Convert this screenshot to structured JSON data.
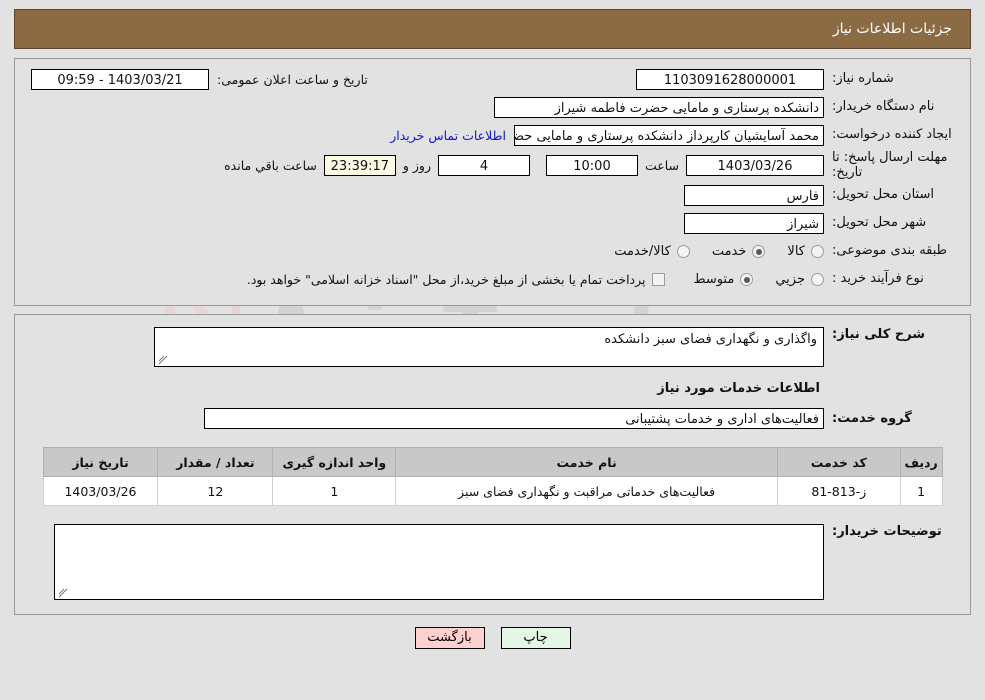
{
  "header": {
    "title": "جزئیات اطلاعات نیاز",
    "bar_color": "#8b6b44"
  },
  "watermark": {
    "text": "AriaTender.net",
    "shield_color": "#f0d2d2",
    "text_color": "#cccccc"
  },
  "top_panel": {
    "need_number": {
      "label": "شماره نیاز:",
      "value": "1103091628000001"
    },
    "announce": {
      "label": "تاریخ و ساعت اعلان عمومی:",
      "value": "09:59 - 1403/03/21"
    },
    "buyer_org": {
      "label": "نام دستگاه خریدار:",
      "value": "دانشکده پرستاری و مامایی حضرت فاطمه شیراز"
    },
    "creator": {
      "label": "ایجاد کننده درخواست:",
      "value": "محمد آسایشیان کارپرداز دانشکده پرستاری و مامایی حضرت فاطمه شیراز",
      "contact_link": "اطلاعات تماس خریدار"
    },
    "deadline": {
      "label": "مهلت ارسال پاسخ: تا تاریخ:",
      "date": "1403/03/26",
      "time_label": "ساعت",
      "time": "10:00",
      "days": "4",
      "days_label": "روز و",
      "remaining": "23:39:17",
      "remaining_label": "ساعت باقي مانده"
    },
    "province": {
      "label": "استان محل تحویل:",
      "value": "فارس"
    },
    "city": {
      "label": "شهر محل تحویل:",
      "value": "شیراز"
    },
    "category": {
      "label": "طبقه بندی موضوعی:",
      "options": [
        {
          "label": "کالا",
          "selected": false
        },
        {
          "label": "خدمت",
          "selected": true
        },
        {
          "label": "کالا/خدمت",
          "selected": false
        }
      ]
    },
    "process_type": {
      "label": "نوع فرآیند خرید :",
      "options": [
        {
          "label": "جزیي",
          "selected": false
        },
        {
          "label": "متوسط",
          "selected": true
        }
      ],
      "checkbox": {
        "checked": false,
        "note": "پرداخت تمام یا بخشی از مبلغ خرید،از محل \"اسناد خزانه اسلامی\" خواهد بود."
      }
    }
  },
  "mid_panel": {
    "general_desc": {
      "label": "شرح کلی نیاز:",
      "value": "واگذاری و نگهداری فضای سبز دانشکده"
    },
    "section_title": "اطلاعات خدمات مورد نیاز",
    "service_group": {
      "label": "گروه خدمت:",
      "value": "فعالیت‌های اداری و خدمات پشتیبانی"
    },
    "table": {
      "columns": [
        "ردیف",
        "کد خدمت",
        "نام خدمت",
        "واحد اندازه گیری",
        "تعداد / مقدار",
        "تاریخ نیاز"
      ],
      "rows": [
        {
          "radif": "1",
          "code": "ز-813-81",
          "name": "فعالیت‌های خدماتی مراقبت و نگهداری فضای سبز",
          "unit": "1",
          "qty": "12",
          "date": "1403/03/26"
        }
      ]
    },
    "buyer_notes": {
      "label": "توضیحات خریدار:",
      "value": ""
    }
  },
  "footer": {
    "print_label": "چاپ",
    "back_label": "بازگشت"
  }
}
